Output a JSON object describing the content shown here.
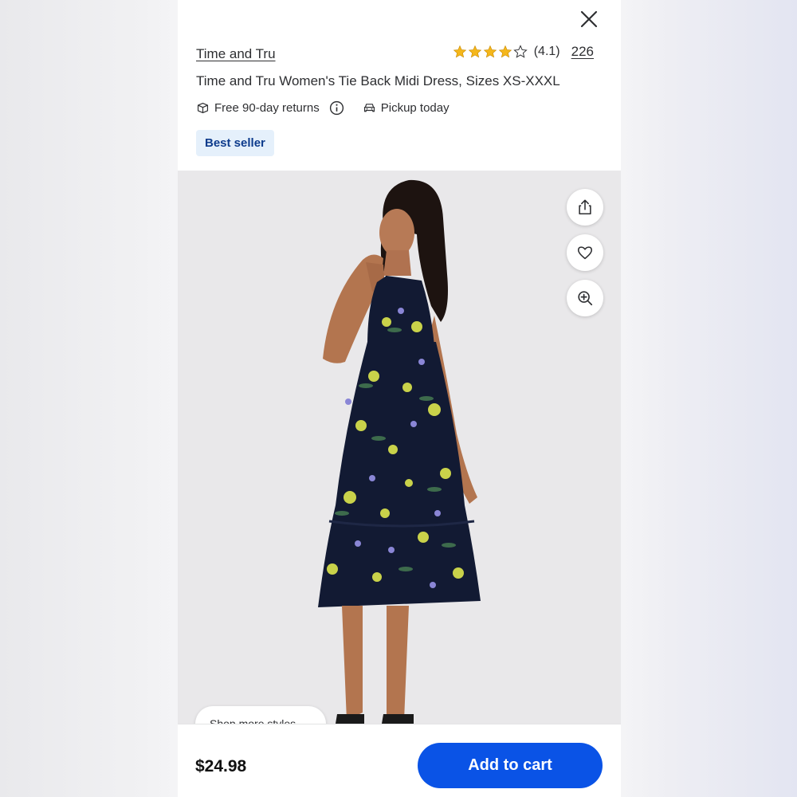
{
  "header": {
    "brand": "Time and Tru",
    "rating_value": "(4.1)",
    "rating_stars": 4.1,
    "review_count": "226",
    "title": "Time and Tru Women's Tie Back Midi Dress, Sizes XS-XXXL"
  },
  "perks": {
    "returns": "Free 90-day returns",
    "pickup": "Pickup today"
  },
  "badge": "Best seller",
  "chip": {
    "label": "Shop more styles"
  },
  "footer": {
    "price": "$24.98",
    "add_to_cart": "Add to cart"
  },
  "colors": {
    "brand_blue": "#0a53e6",
    "badge_bg": "#e5f0fb",
    "badge_text": "#0d3b8c",
    "star": "#f5b71b"
  },
  "icons": {
    "close": "close-icon",
    "share": "share-icon",
    "favorite": "heart-icon",
    "zoom": "zoom-in-icon",
    "returns": "package-return-icon",
    "info": "info-icon",
    "pickup": "car-icon"
  }
}
